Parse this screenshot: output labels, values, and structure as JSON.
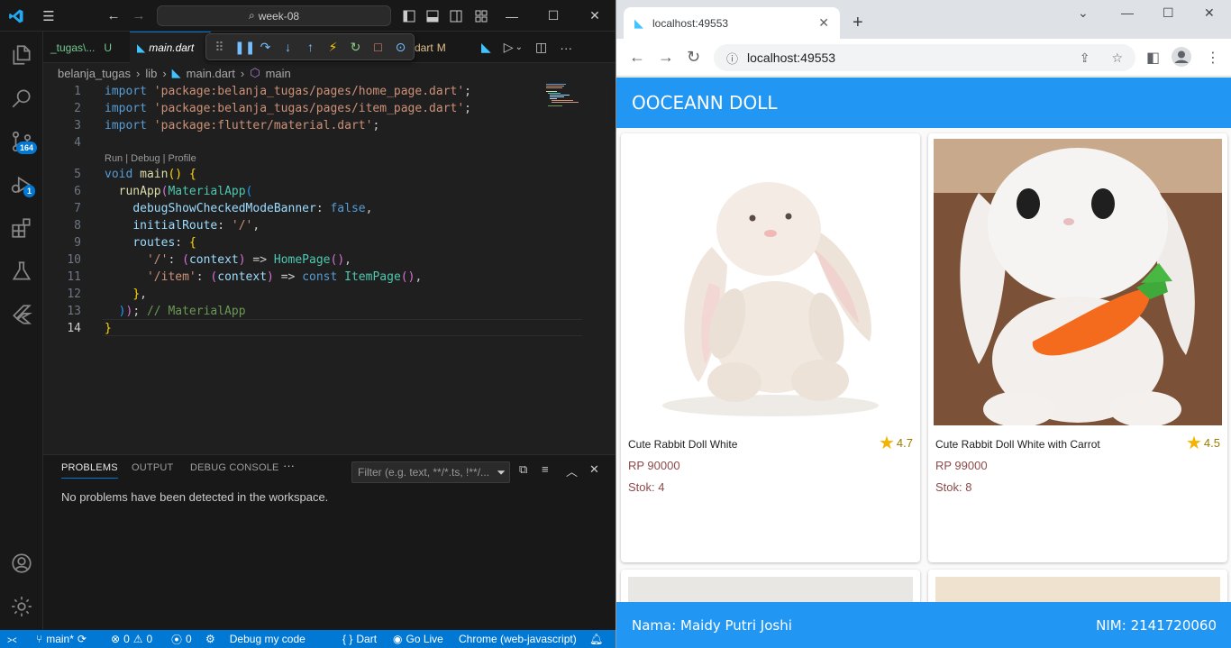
{
  "vscode": {
    "command_center": "week-08",
    "tabs": [
      {
        "label": "_tugas\\...",
        "status": "U"
      },
      {
        "label": "main.dart",
        "status": ""
      },
      {
        "label": "dart",
        "status": "M"
      }
    ],
    "breadcrumb": [
      "belanja_tugas",
      "lib",
      "main.dart",
      "main"
    ],
    "codelens": "Run | Debug | Profile",
    "line_numbers": [
      "1",
      "2",
      "3",
      "4",
      "5",
      "6",
      "7",
      "8",
      "9",
      "10",
      "11",
      "12",
      "13",
      "14"
    ],
    "panel": {
      "tabs": [
        "PROBLEMS",
        "OUTPUT",
        "DEBUG CONSOLE"
      ],
      "filter_placeholder": "Filter (e.g. text, **/*.ts, !**/...",
      "message": "No problems have been detected in the workspace."
    },
    "badges": {
      "source_control": "164",
      "run_debug": "1"
    },
    "status": {
      "branch": "main*",
      "errors": "0",
      "warnings": "0",
      "ports": "0",
      "debug": "Debug my code",
      "language": "Dart",
      "golive": "Go Live",
      "device": "Chrome (web-javascript)"
    }
  },
  "chrome": {
    "tab_title": "localhost:49553",
    "url": "localhost:49553"
  },
  "app": {
    "title": "OOCEANN DOLL",
    "products": [
      {
        "name": "Cute Rabbit Doll White",
        "rating": "4.7",
        "price": "RP 90000",
        "stock": "Stok: 4"
      },
      {
        "name": "Cute Rabbit Doll White with Carrot",
        "rating": "4.5",
        "price": "RP 99000",
        "stock": "Stok: 8"
      }
    ],
    "footer_name": "Nama: Maidy Putri Joshi",
    "footer_nim": "NIM: 2141720060"
  },
  "colors": {
    "vscode_accent": "#0078d4",
    "appbar": "#2196f3",
    "star": "#f5b301",
    "price_text": "#8d4b4b"
  }
}
